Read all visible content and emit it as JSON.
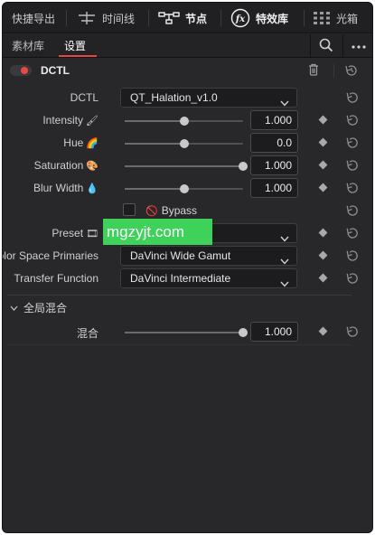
{
  "toolbar": {
    "items": [
      {
        "label": "快捷导出",
        "icon": "none"
      },
      {
        "label": "时间线",
        "icon": "timeline-icon"
      },
      {
        "label": "节点",
        "icon": "nodes-icon"
      },
      {
        "label": "特效库",
        "icon": "fx-icon"
      },
      {
        "label": "光箱",
        "icon": "lightbox-icon"
      }
    ]
  },
  "tabs": {
    "items": [
      {
        "label": "素材库",
        "active": false
      },
      {
        "label": "设置",
        "active": true
      }
    ],
    "accent_color": "#e2483d"
  },
  "node": {
    "title": "DCTL",
    "enabled": true,
    "toggle_color": "#e84a3f"
  },
  "params": {
    "dctl": {
      "label": "DCTL",
      "value": "QT_Halation_v1.0"
    },
    "intensity": {
      "label": "Intensity",
      "emoji": "🖌",
      "value": "1.000",
      "position": 0.5
    },
    "hue": {
      "label": "Hue",
      "emoji": "🌈",
      "value": "0.0",
      "position": 0.5
    },
    "saturation": {
      "label": "Saturation",
      "emoji": "🎨",
      "value": "1.000",
      "position": 1.0
    },
    "blur_width": {
      "label": "Blur Width",
      "emoji": "💧",
      "value": "1.000",
      "position": 0.5
    },
    "bypass": {
      "label": "Bypass",
      "emoji": "🚫",
      "checked": false
    },
    "preset": {
      "label": "Preset",
      "emoji": "🎞",
      "value": ""
    },
    "color_space": {
      "label": "Color Space Primaries",
      "value": "DaVinci Wide Gamut"
    },
    "transfer": {
      "label": "Transfer Function",
      "value": "DaVinci Intermediate"
    }
  },
  "global_blend": {
    "section_label": "全局混合",
    "mix": {
      "label": "混合",
      "value": "1.000",
      "position": 1.0
    }
  },
  "watermark": {
    "text": "mgzyjt.com",
    "color": "#3fd25a"
  }
}
